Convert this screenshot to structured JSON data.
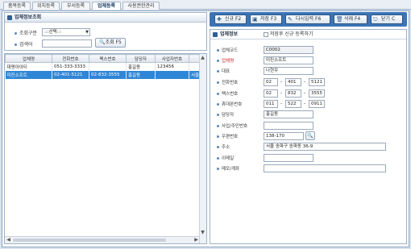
{
  "tabs": [
    {
      "label": "품목등록"
    },
    {
      "label": "위치등록"
    },
    {
      "label": "부서등록"
    },
    {
      "label": "업체등록"
    },
    {
      "label": "사용권한관리"
    }
  ],
  "active_tab": "업체등록",
  "search_panel": {
    "title": "업체정보조회",
    "criteria_label": "조회구분",
    "criteria_value": ":::선택:::",
    "keyword_label": "검색어",
    "keyword_value": "",
    "search_button": "조회 F5"
  },
  "grid": {
    "columns": [
      "업체명",
      "전화번호",
      "팩스번호",
      "담당자",
      "사업자번호",
      ""
    ],
    "rows": [
      [
        "대명아이티",
        "051-333-3333",
        "",
        "홍길동",
        "123456",
        ""
      ],
      [
        "미진소프트",
        "02-401-5121",
        "02-832-3555",
        "홍길동",
        "",
        "서울 송"
      ]
    ],
    "selected_row": 1
  },
  "toolbar": {
    "new_label": "신규 F2",
    "save_label": "저장 F3",
    "reenter_label": "다시입력 F6",
    "delete_label": "삭제 F4",
    "close_label": "닫기 C"
  },
  "detail": {
    "title": "업체정보",
    "checkbox_label": "저장후 신규 등록하기",
    "fields": {
      "code_label": "업체코드",
      "code_value": "C0002",
      "name_label": "업체명",
      "name_value": "미진소프트",
      "rep_label": "대표",
      "rep_value": "나현우",
      "phone_label": "전화번호",
      "phone": [
        "02",
        "401",
        "5121"
      ],
      "fax_label": "팩스번호",
      "fax": [
        "02",
        "832",
        "3555"
      ],
      "mobile_label": "휴대폰번호",
      "mobile": [
        "011",
        "522",
        "0911"
      ],
      "manager_label": "담당자",
      "manager_value": "홍길동",
      "biz_label": "사업/주민번호",
      "biz_value": "",
      "zip_label": "우편번호",
      "zip_value": "138-170",
      "address_label": "주소",
      "address_value": "서울 송파구 송파동 36-9",
      "email_label": "이메일",
      "email_value": "",
      "memo_label": "메모/계좌",
      "memo_value": ""
    }
  }
}
